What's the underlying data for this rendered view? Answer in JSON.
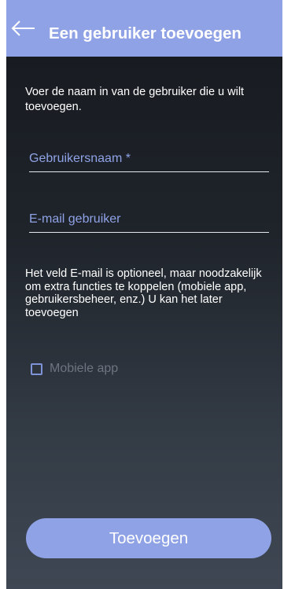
{
  "header": {
    "back_icon": "arrow-left-icon",
    "title": "Een gebruiker toevoegen"
  },
  "form": {
    "intro": "Voer de naam in van de gebruiker die u wilt toevoegen.",
    "username": {
      "placeholder": "Gebruikersnaam *",
      "value": ""
    },
    "email": {
      "placeholder": "E-mail gebruiker",
      "value": ""
    },
    "info": "Het veld E-mail is optioneel, maar noodzakelijk om extra functies te koppelen (mobiele app, gebruikersbeheer, enz.) U kan het later toevoegen",
    "mobile_app": {
      "label": "Mobiele app",
      "checked": false
    },
    "submit_label": "Toevoegen"
  },
  "colors": {
    "accent": "#8fa2e6",
    "background_top": "#16191e",
    "background_bottom": "#3e4753",
    "checkbox_border": "#7f93d9",
    "disabled_text": "#6e7480"
  }
}
